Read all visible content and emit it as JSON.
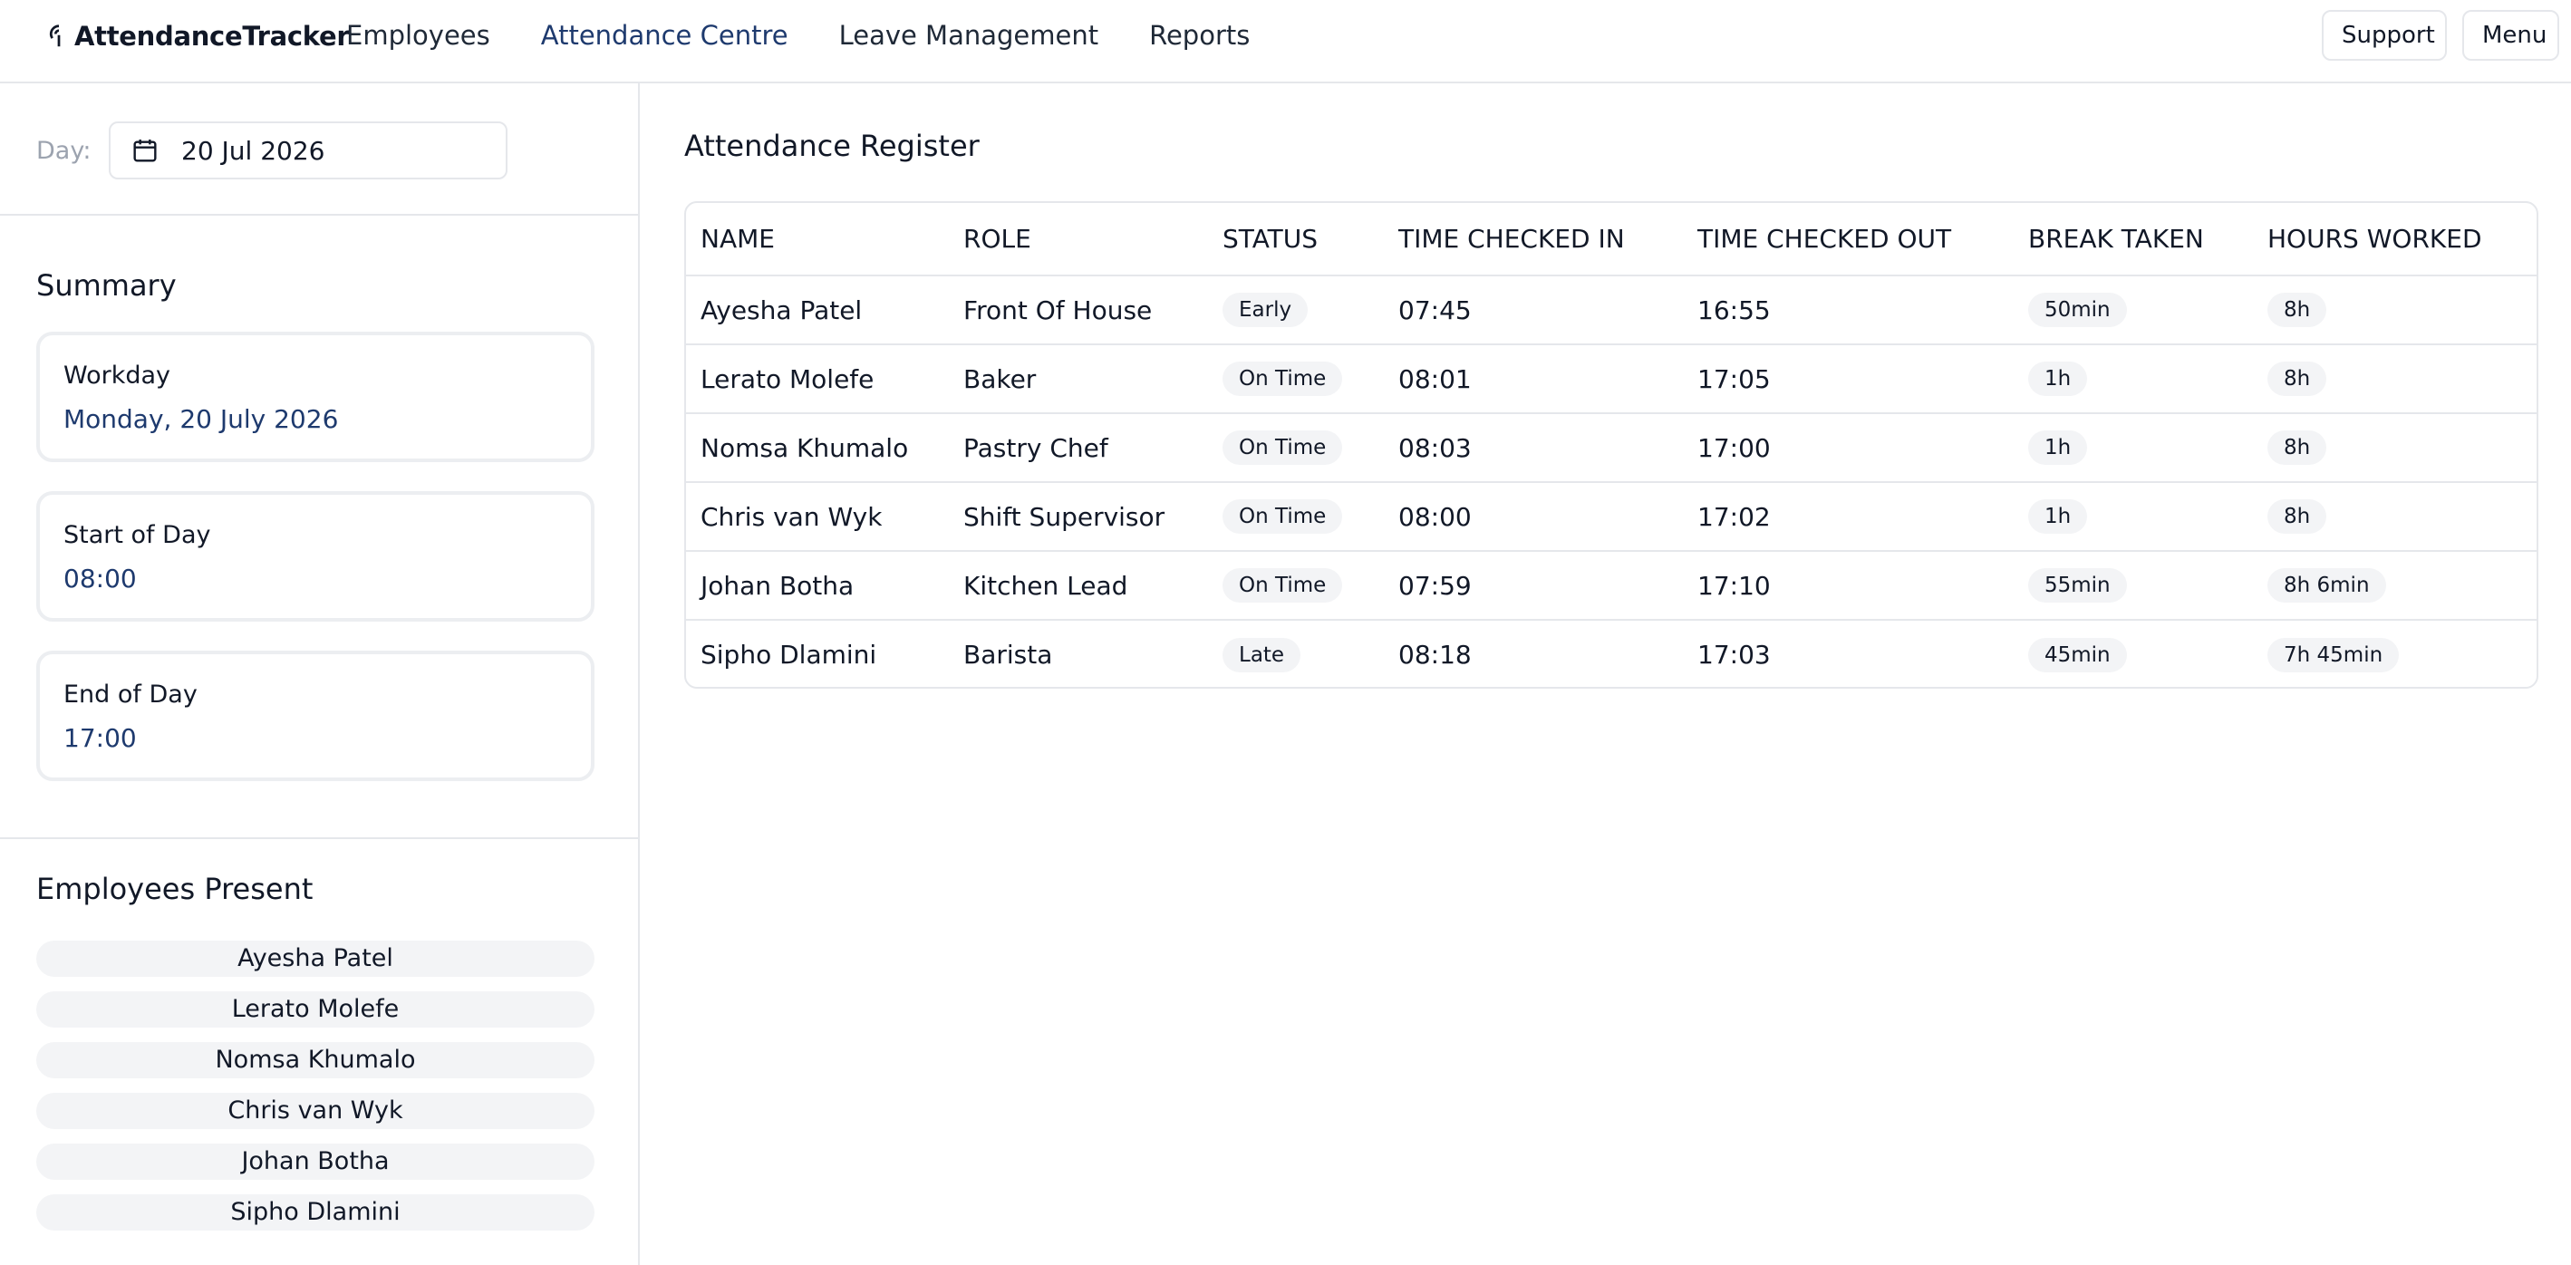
{
  "app": {
    "name": "AttendanceTracker"
  },
  "nav": {
    "items": [
      "Employees",
      "Attendance Centre",
      "Leave Management",
      "Reports"
    ],
    "active": "Attendance Centre"
  },
  "header": {
    "support_label": "Support",
    "menu_label": "Menu"
  },
  "sidebar": {
    "day_label": "Day:",
    "date_value": "20 Jul 2026",
    "summary_title": "Summary",
    "cards": [
      {
        "label": "Workday",
        "value": "Monday, 20 July 2026"
      },
      {
        "label": "Start of Day",
        "value": "08:00"
      },
      {
        "label": "End of Day",
        "value": "17:00"
      }
    ],
    "present_title": "Employees Present",
    "present": [
      "Ayesha Patel",
      "Lerato Molefe",
      "Nomsa Khumalo",
      "Chris van Wyk",
      "Johan Botha",
      "Sipho Dlamini"
    ]
  },
  "register": {
    "title": "Attendance Register",
    "columns": [
      "NAME",
      "ROLE",
      "STATUS",
      "TIME CHECKED IN",
      "TIME CHECKED OUT",
      "BREAK TAKEN",
      "HOURS WORKED"
    ],
    "rows": [
      {
        "name": "Ayesha Patel",
        "role": "Front Of House",
        "status": "Early",
        "in": "07:45",
        "out": "16:55",
        "break": "50min",
        "hours": "8h"
      },
      {
        "name": "Lerato Molefe",
        "role": "Baker",
        "status": "On Time",
        "in": "08:01",
        "out": "17:05",
        "break": "1h",
        "hours": "8h"
      },
      {
        "name": "Nomsa Khumalo",
        "role": "Pastry Chef",
        "status": "On Time",
        "in": "08:03",
        "out": "17:00",
        "break": "1h",
        "hours": "8h"
      },
      {
        "name": "Chris van Wyk",
        "role": "Shift Supervisor",
        "status": "On Time",
        "in": "08:00",
        "out": "17:02",
        "break": "1h",
        "hours": "8h"
      },
      {
        "name": "Johan Botha",
        "role": "Kitchen Lead",
        "status": "On Time",
        "in": "07:59",
        "out": "17:10",
        "break": "55min",
        "hours": "8h 6min"
      },
      {
        "name": "Sipho Dlamini",
        "role": "Barista",
        "status": "Late",
        "in": "08:18",
        "out": "17:03",
        "break": "45min",
        "hours": "7h 45min"
      }
    ]
  },
  "colors": {
    "accent": "#1e3a6e",
    "border": "#e5e7eb",
    "badge_bg": "#f3f4f6",
    "muted": "#9ca3af"
  },
  "icons": {
    "brand": "location-pin-icon",
    "date": "calendar-icon"
  }
}
